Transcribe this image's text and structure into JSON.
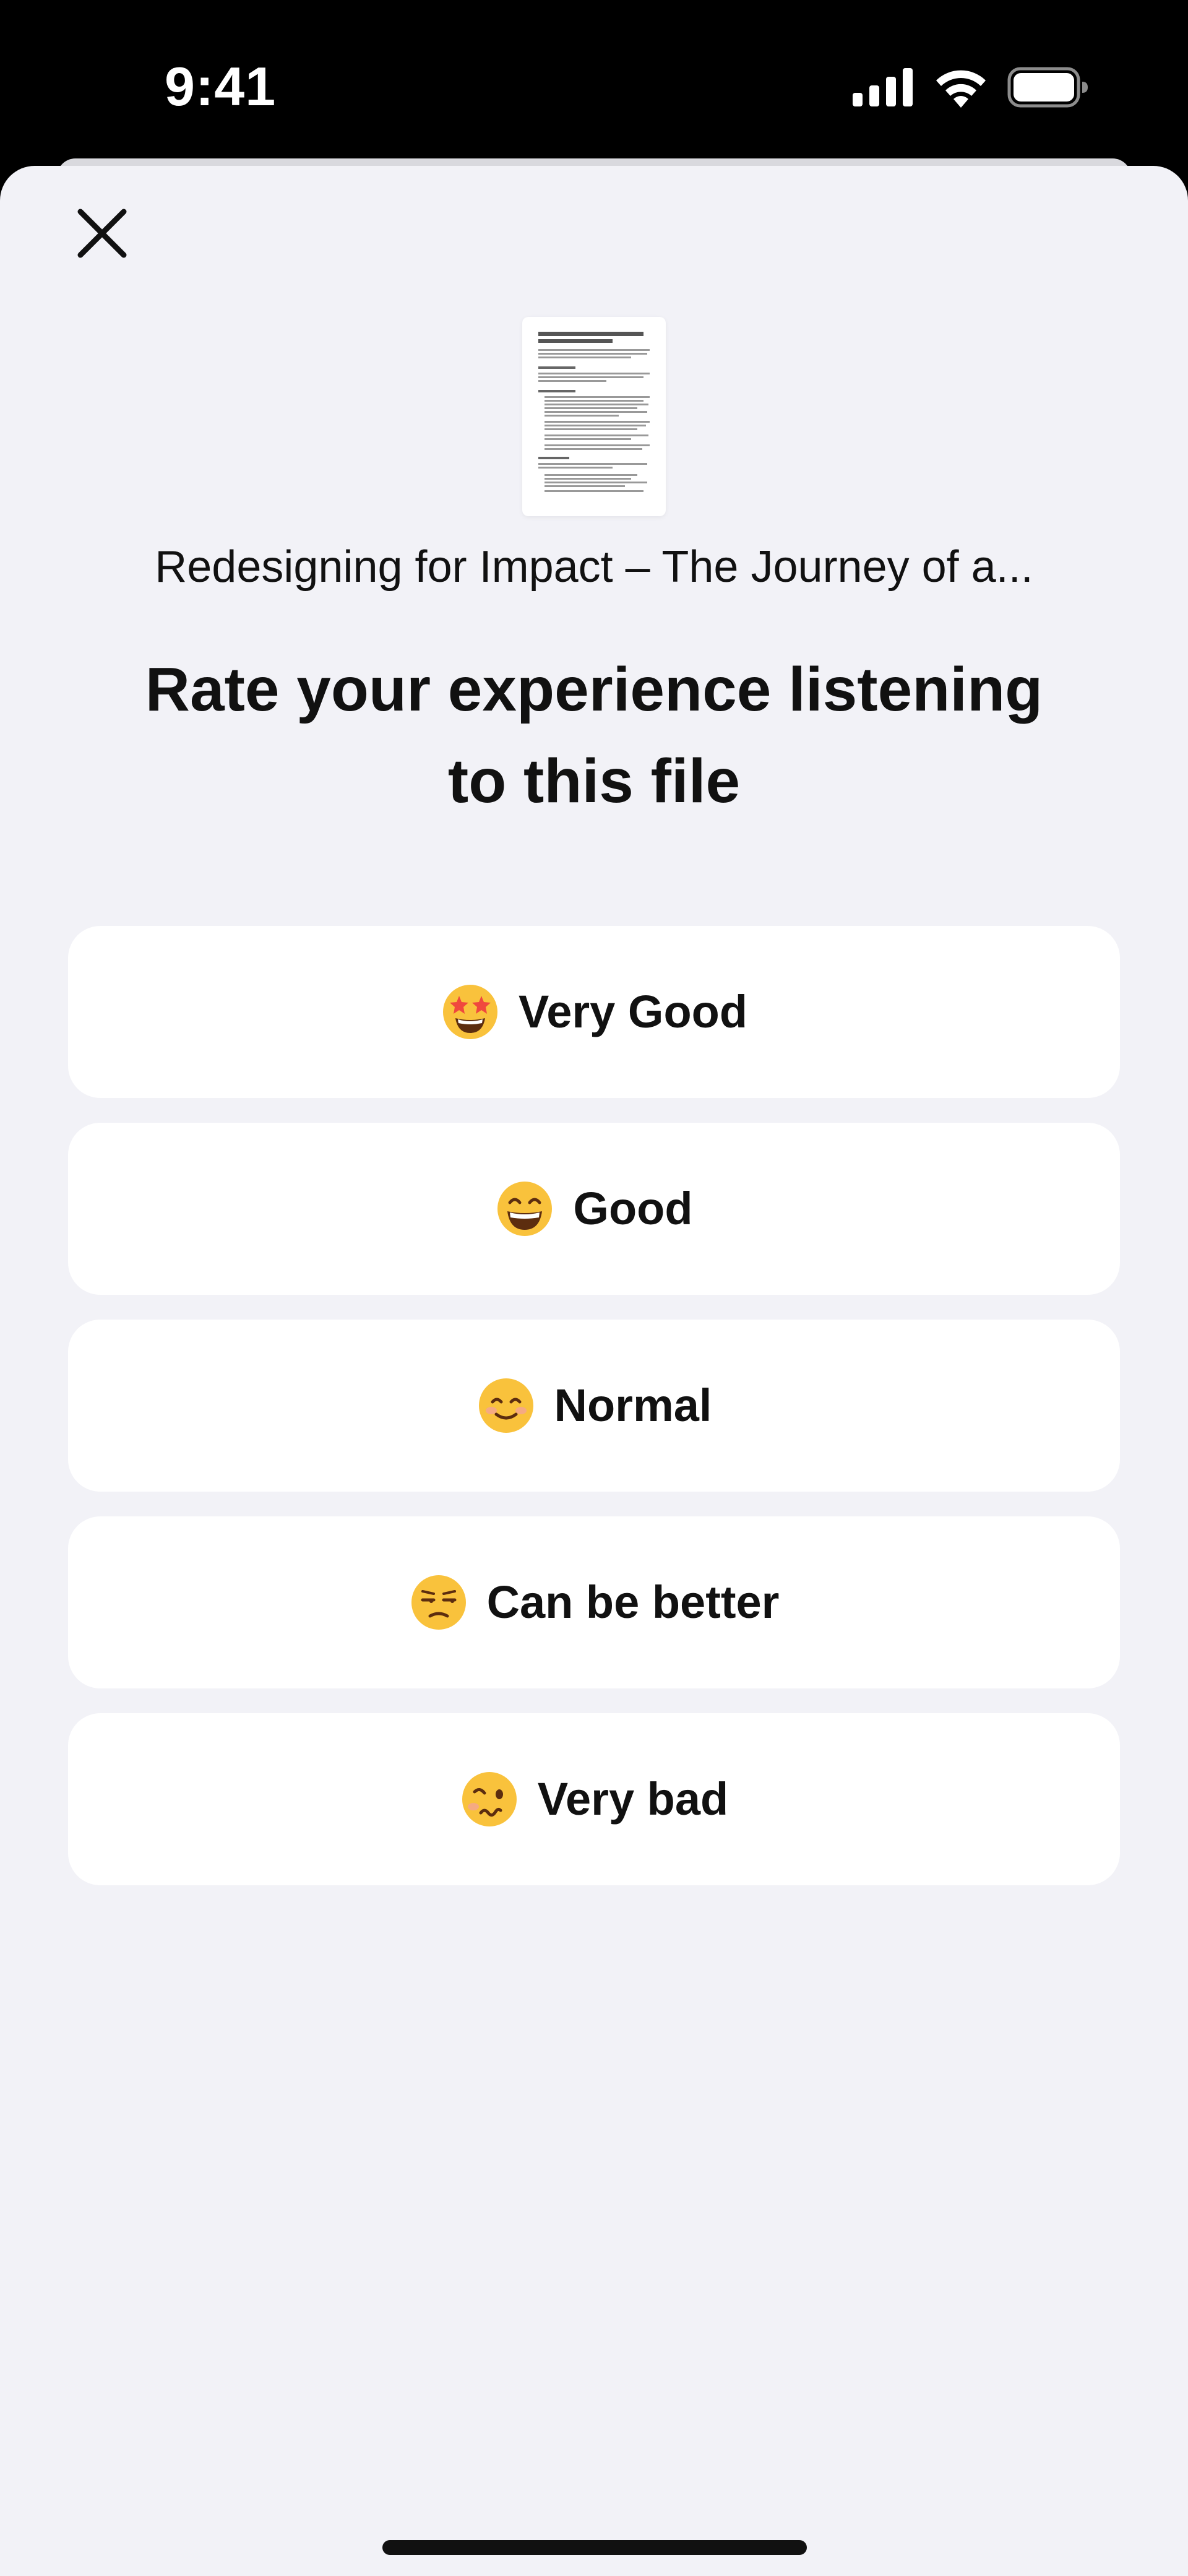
{
  "status_bar": {
    "time": "9:41",
    "icons": [
      "cellular-signal-icon",
      "wifi-icon",
      "battery-icon"
    ]
  },
  "sheet": {
    "close_icon": "close-icon",
    "document_thumbnail_lines": [
      "Redesigning for Impact – The Journey of a Product Designer",
      "The Challenge",
      "The Approach",
      "The Results"
    ],
    "file_title": "Redesigning for Impact – The Journey of a...",
    "heading": "Rate your experience listening to this file",
    "options": [
      {
        "label": "Very Good",
        "emoji": "star-struck-emoji-icon"
      },
      {
        "label": "Good",
        "emoji": "grinning-face-emoji-icon"
      },
      {
        "label": "Normal",
        "emoji": "smiling-face-emoji-icon"
      },
      {
        "label": "Can be better",
        "emoji": "unamused-face-emoji-icon"
      },
      {
        "label": "Very bad",
        "emoji": "woozy-face-emoji-icon"
      }
    ]
  },
  "colors": {
    "status_bar_bg": "#000000",
    "sheet_bg": "#f2f2f7",
    "card_bg": "#ffffff",
    "text": "#111111",
    "emoji_yellow": "#f9c23c"
  }
}
